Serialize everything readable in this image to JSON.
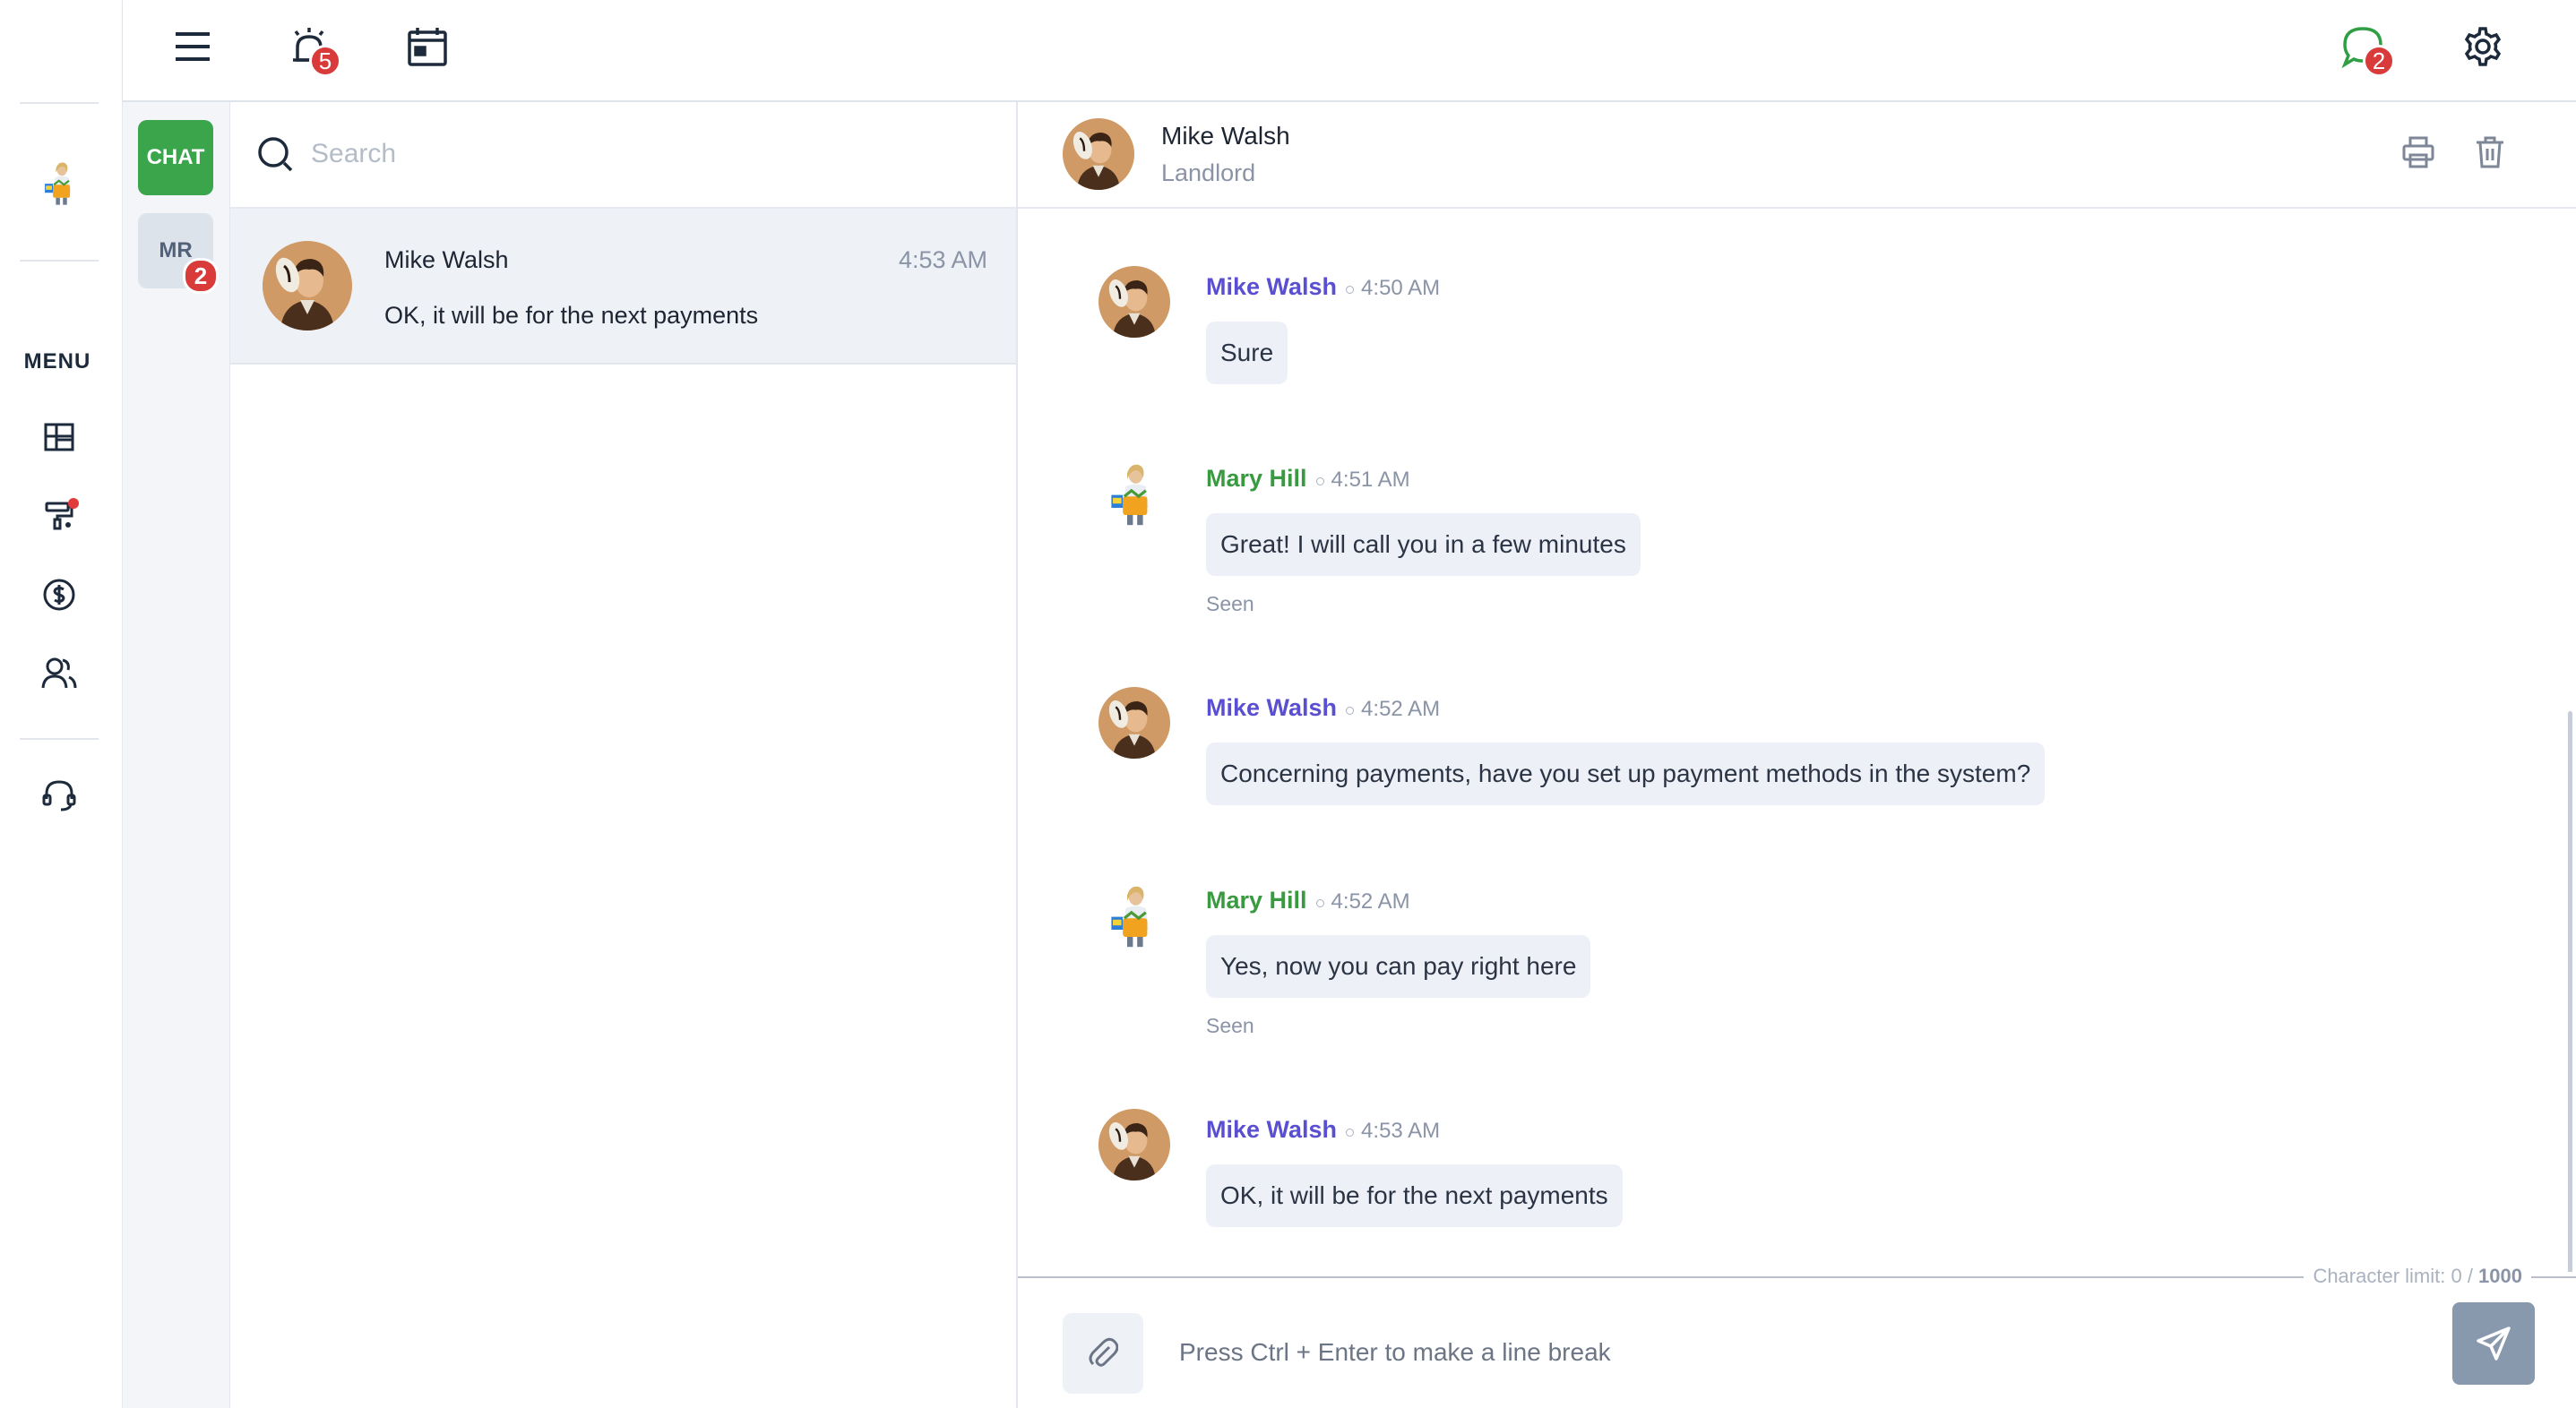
{
  "topbar": {
    "alarm_badge": "5",
    "chat_badge": "2",
    "icons": [
      "menu-icon",
      "alarm-icon",
      "calendar-icon",
      "chat-bubble-icon",
      "gear-icon"
    ]
  },
  "leftnav": {
    "menu_label": "MENU",
    "items": [
      "dashboard-icon",
      "paint-roller-icon",
      "dollar-icon",
      "users-icon",
      "headset-icon"
    ]
  },
  "tabs": {
    "chat_label": "CHAT",
    "mr_label": "MR",
    "mr_badge": "2"
  },
  "search": {
    "placeholder": "Search"
  },
  "conversations": [
    {
      "name": "Mike Walsh",
      "time": "4:53 AM",
      "preview": "OK, it will be for the next payments"
    }
  ],
  "chat_header": {
    "name": "Mike Walsh",
    "role": "Landlord"
  },
  "messages": [
    {
      "sender": "Mike Walsh",
      "time": "4:50 AM",
      "text": "Sure",
      "seen": ""
    },
    {
      "sender": "Mary Hill",
      "time": "4:51 AM",
      "text": "Great! I will call you in a few minutes",
      "seen": "Seen"
    },
    {
      "sender": "Mike Walsh",
      "time": "4:52 AM",
      "text": "Concerning payments, have you set up payment methods in the system?",
      "seen": ""
    },
    {
      "sender": "Mary Hill",
      "time": "4:52 AM",
      "text": "Yes, now you can pay right here",
      "seen": "Seen"
    },
    {
      "sender": "Mike Walsh",
      "time": "4:53 AM",
      "text": "OK, it will be for the next payments",
      "seen": ""
    }
  ],
  "composer": {
    "char_limit_label": "Character limit: 0 / ",
    "char_limit_max": "1000",
    "placeholder": "Press Ctrl + Enter to make a line break"
  },
  "colors": {
    "chat_tab": "#3aa54a",
    "mike_name": "#5a4fd0",
    "mary_name": "#3a9a42",
    "badge": "#d93a3a",
    "send_button": "#8898ad"
  }
}
